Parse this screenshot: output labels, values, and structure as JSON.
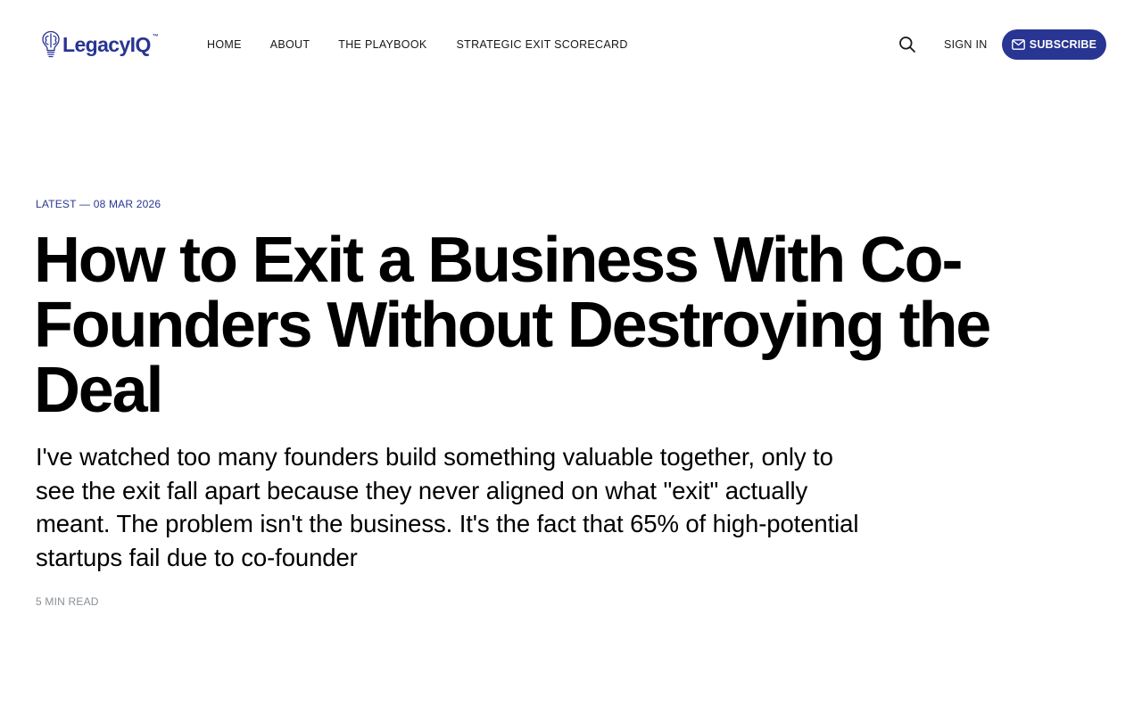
{
  "brand": {
    "name": "LegacyIQ",
    "trademark": "™",
    "accent_color": "#283593"
  },
  "nav": {
    "items": [
      {
        "label": "HOME"
      },
      {
        "label": "ABOUT"
      },
      {
        "label": "THE PLAYBOOK"
      },
      {
        "label": "STRATEGIC EXIT SCORECARD"
      }
    ]
  },
  "header_actions": {
    "search_icon": "search-icon",
    "sign_in_label": "SIGN IN",
    "subscribe_label": "SUBSCRIBE",
    "subscribe_icon": "mail-icon"
  },
  "article": {
    "meta_label": "LATEST — 08 MAR 2026",
    "title": "How to Exit a Business With Co-Founders Without Destroying the Deal",
    "excerpt": "I've watched too many founders build something valuable together, only to see the exit fall apart because they never aligned on what \"exit\" actually meant. The problem isn't the business. It's the fact that 65% of high-potential startups fail due to co-founder",
    "reading_time": "5 MIN READ"
  }
}
